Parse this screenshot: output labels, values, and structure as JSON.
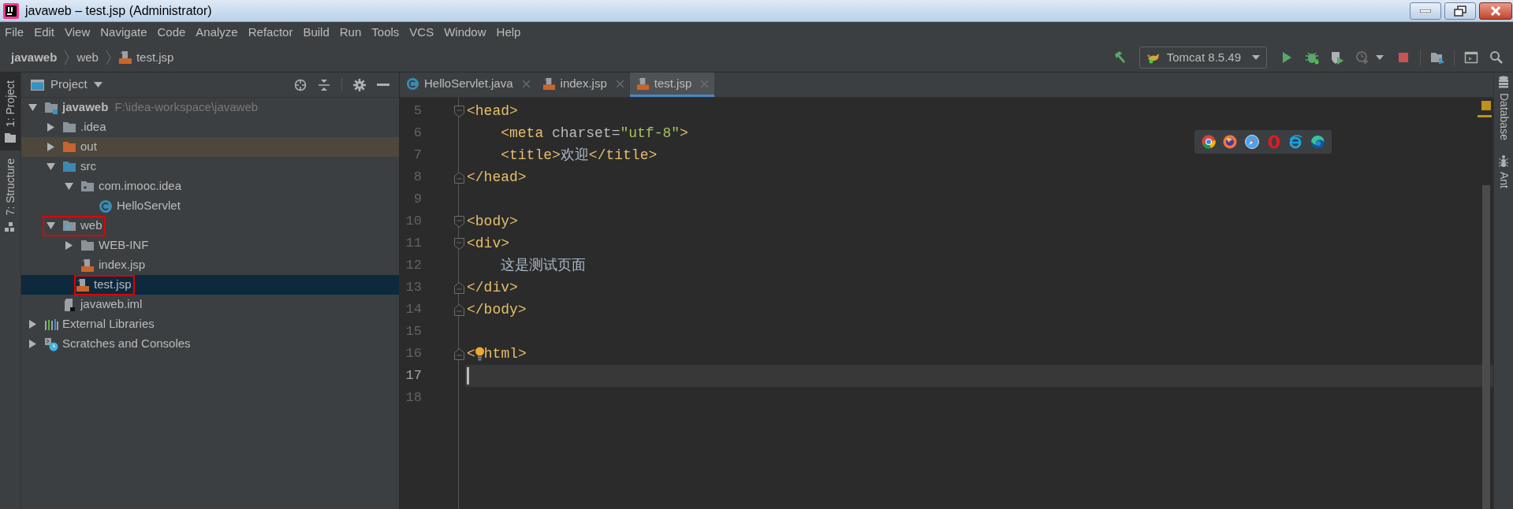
{
  "window": {
    "title": "javaweb – test.jsp (Administrator)"
  },
  "menu": [
    "File",
    "Edit",
    "View",
    "Navigate",
    "Code",
    "Analyze",
    "Refactor",
    "Build",
    "Run",
    "Tools",
    "VCS",
    "Window",
    "Help"
  ],
  "breadcrumbs": [
    {
      "label": "javaweb",
      "kind": "project"
    },
    {
      "label": "web",
      "kind": "folder"
    },
    {
      "label": "test.jsp",
      "kind": "jsp"
    }
  ],
  "toolbar": {
    "run_config": "Tomcat 8.5.49",
    "buttons": [
      {
        "kind": "build",
        "disabled": false
      },
      {
        "kind": "run",
        "disabled": false
      },
      {
        "kind": "debug",
        "disabled": false
      },
      {
        "kind": "coverage",
        "disabled": false
      },
      {
        "kind": "profile",
        "disabled": true
      },
      {
        "kind": "stop",
        "disabled": false
      },
      {
        "kind": "structure",
        "disabled": false
      },
      {
        "kind": "terminal",
        "disabled": false
      },
      {
        "kind": "search",
        "disabled": false
      }
    ]
  },
  "left_stripe": [
    {
      "label": "1: Project",
      "kind": "project",
      "selected": true
    },
    {
      "label": "7: Structure",
      "kind": "structure",
      "selected": false
    }
  ],
  "project_panel": {
    "title": "Project",
    "tree": [
      {
        "label": "javaweb",
        "path": "F:\\idea-workspace\\javaweb",
        "kind": "project",
        "expanded": true,
        "selected": false,
        "highlighted": false,
        "annotated": false,
        "children": [
          {
            "label": ".idea",
            "kind": "folder",
            "expanded": false,
            "selected": false,
            "highlighted": false,
            "annotated": false
          },
          {
            "label": "out",
            "kind": "excluded",
            "expanded": false,
            "selected": false,
            "highlighted": true,
            "annotated": false
          },
          {
            "label": "src",
            "kind": "source",
            "expanded": true,
            "selected": false,
            "highlighted": false,
            "annotated": false,
            "children": [
              {
                "label": "com.imooc.idea",
                "kind": "package",
                "expanded": true,
                "selected": false,
                "highlighted": false,
                "annotated": false,
                "children": [
                  {
                    "label": "HelloServlet",
                    "kind": "class",
                    "selected": false,
                    "highlighted": false,
                    "annotated": false
                  }
                ]
              }
            ]
          },
          {
            "label": "web",
            "kind": "web",
            "expanded": true,
            "selected": false,
            "highlighted": false,
            "annotated": true,
            "children": [
              {
                "label": "WEB-INF",
                "kind": "folder",
                "expanded": false,
                "selected": false,
                "highlighted": false,
                "annotated": false
              },
              {
                "label": "index.jsp",
                "kind": "jsp",
                "selected": false,
                "highlighted": false,
                "annotated": false
              },
              {
                "label": "test.jsp",
                "kind": "jsp",
                "selected": true,
                "highlighted": false,
                "annotated": true
              }
            ]
          },
          {
            "label": "javaweb.iml",
            "kind": "iml",
            "selected": false,
            "highlighted": false,
            "annotated": false
          }
        ]
      },
      {
        "label": "External Libraries",
        "kind": "libraries",
        "expanded": false,
        "selected": false,
        "highlighted": false,
        "annotated": false
      },
      {
        "label": "Scratches and Consoles",
        "kind": "scratches",
        "expanded": false,
        "selected": false,
        "highlighted": false,
        "annotated": false
      }
    ]
  },
  "editor_tabs": [
    {
      "label": "HelloServlet.java",
      "kind": "class",
      "selected": false
    },
    {
      "label": "index.jsp",
      "kind": "jsp",
      "selected": false
    },
    {
      "label": "test.jsp",
      "kind": "jsp",
      "selected": true
    }
  ],
  "editor": {
    "lines": [
      {
        "number": "5",
        "fold_open": true,
        "fold_close": false,
        "current": false,
        "intention": false,
        "tokens": [
          {
            "kind": "tag",
            "text": "<head>"
          }
        ]
      },
      {
        "number": "6",
        "fold_open": false,
        "fold_close": false,
        "current": false,
        "intention": false,
        "tokens": [
          {
            "kind": "tag",
            "text": "    <meta"
          },
          {
            "kind": "attr",
            "text": " charset="
          },
          {
            "kind": "string",
            "text": "\"utf-8\""
          },
          {
            "kind": "tag",
            "text": ">"
          }
        ]
      },
      {
        "number": "7",
        "fold_open": false,
        "fold_close": false,
        "current": false,
        "intention": false,
        "tokens": [
          {
            "kind": "tag",
            "text": "    <title>"
          },
          {
            "kind": "plain",
            "text": "欢迎"
          },
          {
            "kind": "tag",
            "text": "</title>"
          }
        ]
      },
      {
        "number": "8",
        "fold_open": false,
        "fold_close": true,
        "current": false,
        "intention": false,
        "tokens": [
          {
            "kind": "tag",
            "text": "</head>"
          }
        ]
      },
      {
        "number": "9",
        "fold_open": false,
        "fold_close": false,
        "current": false,
        "intention": false
      },
      {
        "number": "10",
        "fold_open": true,
        "fold_close": false,
        "current": false,
        "intention": false,
        "tokens": [
          {
            "kind": "tag",
            "text": "<body>"
          }
        ]
      },
      {
        "number": "11",
        "fold_open": true,
        "fold_close": false,
        "current": false,
        "intention": false,
        "tokens": [
          {
            "kind": "tag",
            "text": "<div>"
          }
        ]
      },
      {
        "number": "12",
        "fold_open": false,
        "fold_close": false,
        "current": false,
        "intention": false,
        "tokens": [
          {
            "kind": "plain",
            "text": "    这是测试页面"
          }
        ]
      },
      {
        "number": "13",
        "fold_open": false,
        "fold_close": true,
        "current": false,
        "intention": false,
        "tokens": [
          {
            "kind": "tag",
            "text": "</div>"
          }
        ]
      },
      {
        "number": "14",
        "fold_open": false,
        "fold_close": true,
        "current": false,
        "intention": false,
        "tokens": [
          {
            "kind": "tag",
            "text": "</body>"
          }
        ]
      },
      {
        "number": "15",
        "fold_open": false,
        "fold_close": false,
        "current": false,
        "intention": false
      },
      {
        "number": "16",
        "fold_open": false,
        "fold_close": true,
        "current": false,
        "intention": true,
        "tokens": [
          {
            "kind": "tag",
            "text": "<"
          },
          {
            "kind": "tag",
            "text": "html>"
          }
        ]
      },
      {
        "number": "17",
        "fold_open": false,
        "fold_close": false,
        "current": true,
        "intention": false
      },
      {
        "number": "18",
        "fold_open": false,
        "fold_close": false,
        "current": false,
        "intention": false
      }
    ]
  },
  "right_stripe": [
    {
      "label": "Database",
      "kind": "database"
    },
    {
      "label": "Ant",
      "kind": "ant"
    }
  ]
}
